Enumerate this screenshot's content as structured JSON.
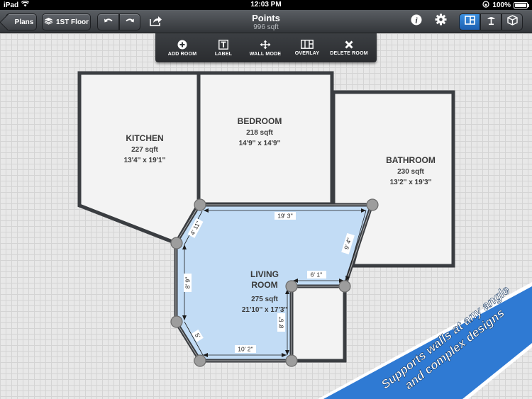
{
  "status_bar": {
    "device": "iPad",
    "time": "12:03 PM",
    "battery": "100%",
    "battery_level": 1.0
  },
  "toolbar": {
    "back_label": "Plans",
    "floor_label": "1ST Floor",
    "title": "Points",
    "subtitle": "996 sqft",
    "icons": [
      "undo-icon",
      "redo-icon",
      "share-icon",
      "info-icon",
      "gear-icon",
      "floor-plan-view-icon",
      "furniture-view-icon",
      "3d-view-icon"
    ],
    "active_view": "floor-plan-view"
  },
  "edit_toolbar": {
    "add_room": "ADD ROOM",
    "label": "LABEL",
    "wall_mode": "WALL MODE",
    "overlay": "OVERLAY",
    "delete_room": "DELETE ROOM"
  },
  "rooms": {
    "kitchen": {
      "name": "KITCHEN",
      "area": "227 sqft",
      "dims": "13'4'' x 19'1''"
    },
    "bedroom": {
      "name": "BEDROOM",
      "area": "218 sqft",
      "dims": "14'9'' x 14'9''"
    },
    "bathroom": {
      "name": "BATHROOM",
      "area": "230 sqft",
      "dims": "13'2'' x 19'3''"
    },
    "living_room": {
      "name_line1": "LIVING",
      "name_line2": "ROOM",
      "area": "275 sqft",
      "dims": "21'10'' x 17'3''"
    }
  },
  "dimensions": {
    "top": "19' 3''",
    "right_angled": "9' 4''",
    "inner_top": "6' 1''",
    "inner_vertical": "8' 5''",
    "bottom": "10' 2''",
    "left": "8' 9''",
    "upper_left_angled": "4' 11''",
    "lower_left_angled": "5'"
  },
  "colors": {
    "selected_room_fill": "#c2dcf5",
    "wall": "#3a3d41",
    "promo_banner": "#2f7ad3"
  },
  "promo": {
    "line1": "Supports walls at any angle",
    "line2": "and complex designs"
  }
}
